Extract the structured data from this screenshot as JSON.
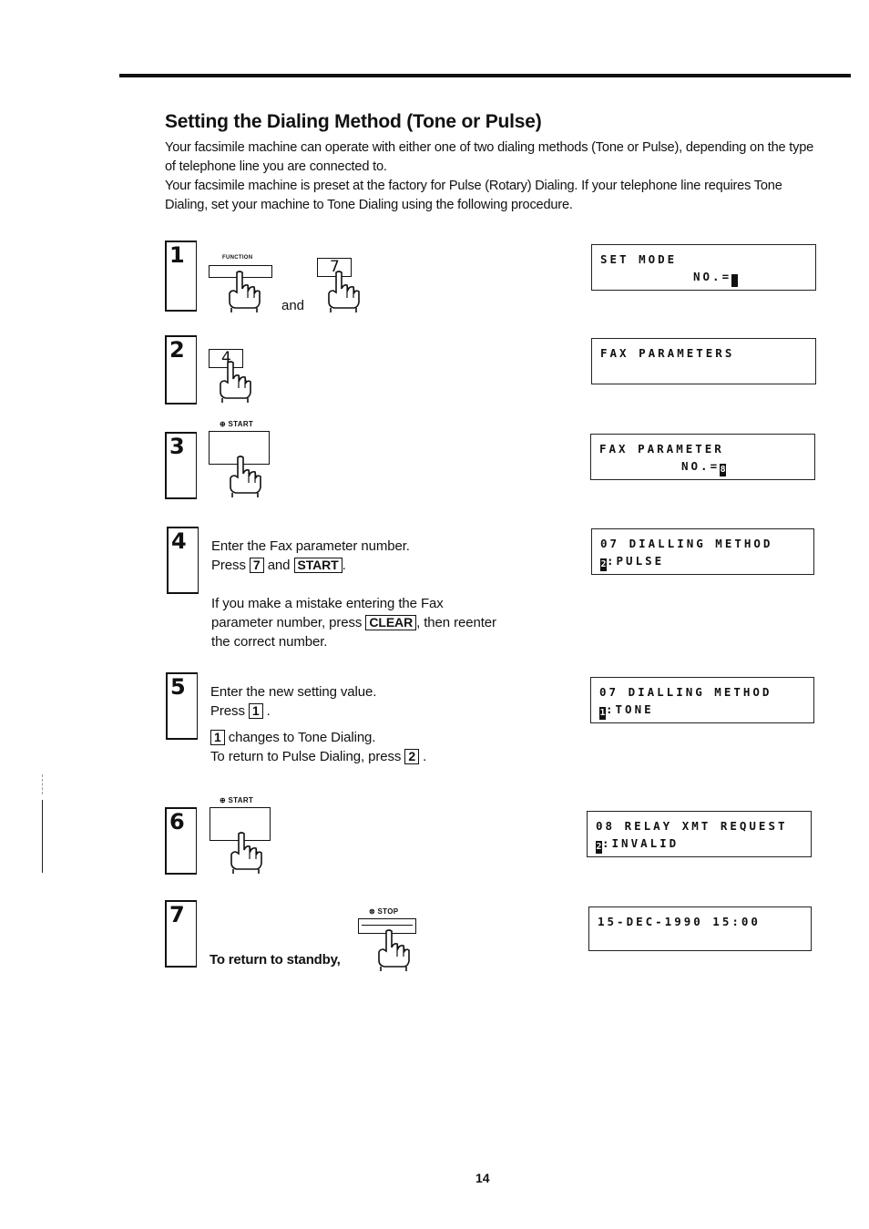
{
  "page": {
    "title": "Setting the Dialing Method (Tone or Pulse)",
    "intro": [
      "Your facsimile machine can operate with either one of two dialing methods (Tone or Pulse), depending on the type of telephone line you are connected to.",
      "Your facsimile machine is preset at the factory for Pulse (Rotary) Dialing. If your telephone line requires Tone Dialing, set your machine to Tone Dialing using the following procedure."
    ],
    "page_number": "14"
  },
  "steps": [
    {
      "number": "1",
      "key_label": "FUNCTION",
      "connector": "and",
      "second_key": "7",
      "display": {
        "line1": "SET MODE",
        "line2_prefix": "NO.=",
        "cursor": " "
      }
    },
    {
      "number": "2",
      "key": "4",
      "display": {
        "line1": "FAX PARAMETERS",
        "line2_prefix": "",
        "cursor": ""
      }
    },
    {
      "number": "3",
      "key_label": "⊕ START",
      "display": {
        "line1": "FAX PARAMETER",
        "line2_prefix": "NO.=",
        "cursor": "8"
      }
    },
    {
      "number": "4",
      "lines": [
        "Enter the Fax parameter number.",
        "Press",
        "and",
        "."
      ],
      "keys": [
        "7",
        "START"
      ],
      "note_before": "If you make a mistake entering the Fax parameter number, press",
      "note_key": "CLEAR",
      "note_after": ", then reenter the correct number.",
      "display": {
        "line1": "07 DIALLING METHOD",
        "line2_prefix": ":PULSE",
        "cursor": "2"
      }
    },
    {
      "number": "5",
      "line1": "Enter the new setting value.",
      "press": "Press",
      "key": "1",
      "note1_after": "changes to Tone Dialing.",
      "note2": "To return to Pulse Dialing, press",
      "note2_key": "2",
      "display": {
        "line1": "07 DIALLING METHOD",
        "line2_prefix": ":TONE",
        "cursor": "1"
      }
    },
    {
      "number": "6",
      "key_label": "⊕ START",
      "display": {
        "line1": "08 RELAY XMT REQUEST",
        "line2_prefix": ":INVALID",
        "cursor": "2"
      }
    },
    {
      "number": "7",
      "text": "To return to standby,",
      "key_label": "⊗ STOP",
      "display": {
        "line1": "15-DEC-1990 15:00",
        "line2_prefix": "",
        "cursor": ""
      }
    }
  ]
}
